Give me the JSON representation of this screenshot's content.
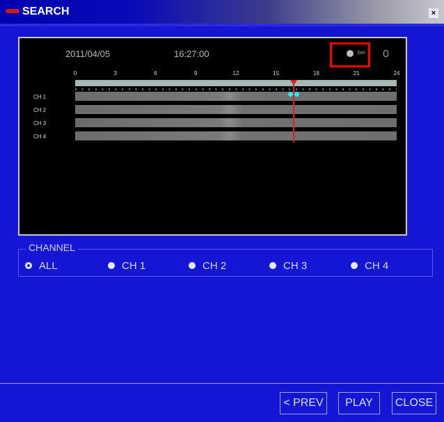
{
  "window": {
    "title": "SEARCH",
    "close_label": "×"
  },
  "timeline": {
    "date": "2011/04/05",
    "time": "16:27:00",
    "hour_ticks": [
      "0",
      "3",
      "6",
      "9",
      "12",
      "15",
      "18",
      "21",
      "24"
    ],
    "zoom_label": "bei",
    "channels": [
      "CH 1",
      "CH 2",
      "CH 3",
      "CH 4"
    ]
  },
  "channel_section": {
    "legend": "CHANNEL",
    "options": [
      {
        "label": "ALL",
        "selected": true
      },
      {
        "label": "CH 1",
        "selected": false
      },
      {
        "label": "CH 2",
        "selected": false
      },
      {
        "label": "CH 3",
        "selected": false
      },
      {
        "label": "CH 4",
        "selected": false
      }
    ]
  },
  "buttons": {
    "prev": "< PREV",
    "play": "PLAY",
    "close": "CLOSE"
  },
  "colors": {
    "window_bg": "#1515d4",
    "cursor": "#e02020",
    "marker": "#2ee8f0",
    "highlight": "#ff0000"
  }
}
